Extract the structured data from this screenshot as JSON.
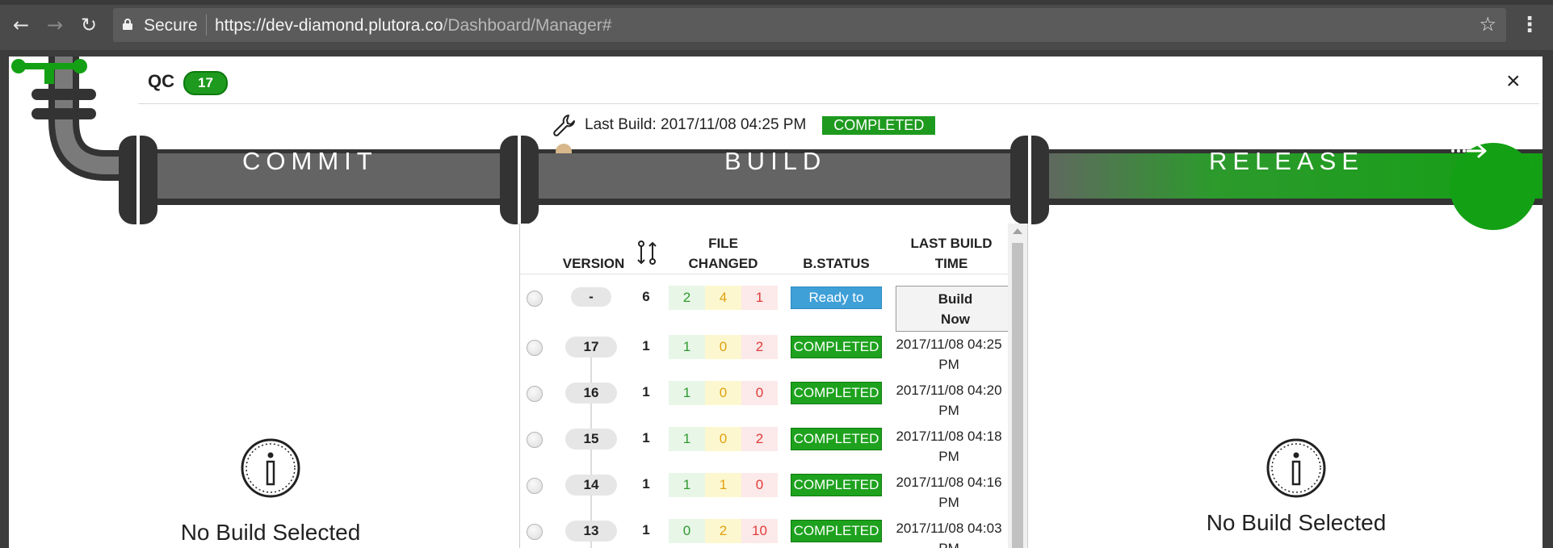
{
  "browser": {
    "secure_label": "Secure",
    "url_host": "https://dev-diamond.plutora.co",
    "url_path": "/Dashboard/Manager#"
  },
  "modal": {
    "title": "QC",
    "badge_count": "17",
    "close_symbol": "×",
    "last_build_text": "Last Build: 2017/11/08 04:25 PM",
    "last_build_status": "COMPLETED"
  },
  "stages": {
    "commit": "COMMIT",
    "build": "BUILD",
    "release": "RELEASE"
  },
  "table": {
    "headers": {
      "version": "VERSION",
      "file_changed_1": "FILE",
      "file_changed_2": "CHANGED",
      "b_status": "B.STATUS",
      "last_build_time_1": "LAST BUILD",
      "last_build_time_2": "TIME"
    },
    "rows": [
      {
        "version": "-",
        "commits": "6",
        "added": "2",
        "modified": "4",
        "deleted": "1",
        "status": "Ready to",
        "action": "Build Now"
      },
      {
        "version": "17",
        "commits": "1",
        "added": "1",
        "modified": "0",
        "deleted": "2",
        "status": "COMPLETED",
        "time_1": "2017/11/08 04:25",
        "time_2": "PM"
      },
      {
        "version": "16",
        "commits": "1",
        "added": "1",
        "modified": "0",
        "deleted": "0",
        "status": "COMPLETED",
        "time_1": "2017/11/08 04:20",
        "time_2": "PM"
      },
      {
        "version": "15",
        "commits": "1",
        "added": "1",
        "modified": "0",
        "deleted": "2",
        "status": "COMPLETED",
        "time_1": "2017/11/08 04:18",
        "time_2": "PM"
      },
      {
        "version": "14",
        "commits": "1",
        "added": "1",
        "modified": "1",
        "deleted": "0",
        "status": "COMPLETED",
        "time_1": "2017/11/08 04:16",
        "time_2": "PM"
      },
      {
        "version": "13",
        "commits": "1",
        "added": "0",
        "modified": "2",
        "deleted": "10",
        "status": "COMPLETED",
        "time_1": "2017/11/08 04:03",
        "time_2": "PM"
      }
    ]
  },
  "panels": {
    "commit_empty": "No Build Selected",
    "release_empty": "No Build Selected"
  },
  "colors": {
    "completed": "#1ea21e",
    "ready": "#3fa0d8",
    "pipe": "#646464",
    "pipe_dark": "#333333"
  }
}
